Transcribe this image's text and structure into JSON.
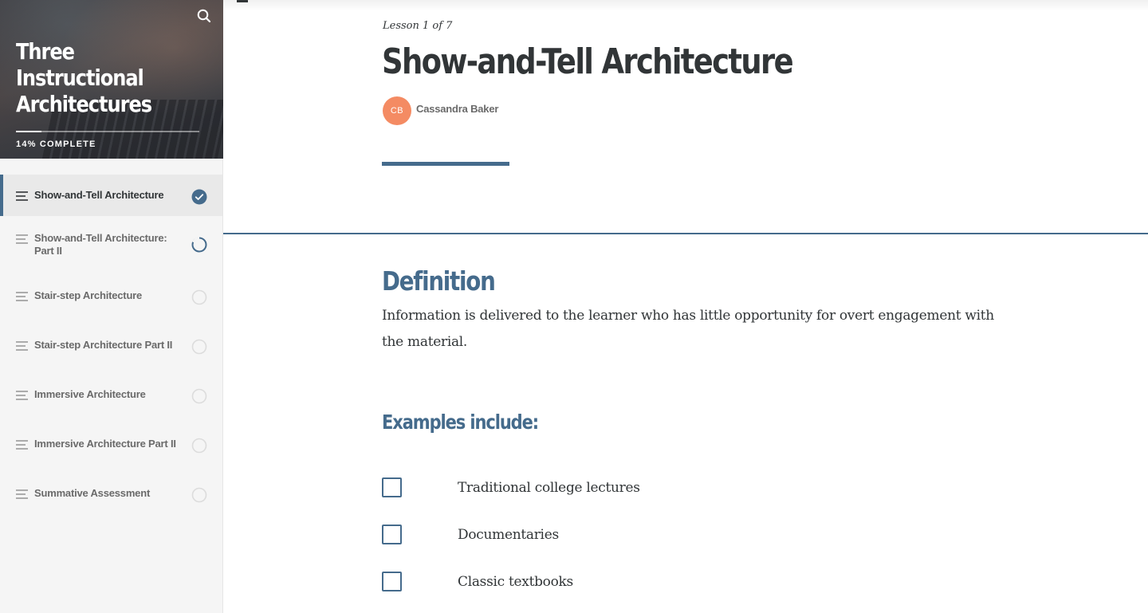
{
  "sidebar": {
    "course_title": "Three Instructional Architectures",
    "progress": {
      "label": "14% COMPLETE",
      "fraction": 0.14
    },
    "search_icon": "search-icon",
    "lessons": [
      {
        "title": "Show-and-Tell Architecture",
        "status": "complete",
        "active": true
      },
      {
        "title": "Show-and-Tell Architecture: Part II",
        "status": "in-progress",
        "active": false
      },
      {
        "title": "Stair-step Architecture",
        "status": "not-started",
        "active": false
      },
      {
        "title": "Stair-step Architecture Part II",
        "status": "not-started",
        "active": false
      },
      {
        "title": "Immersive Architecture",
        "status": "not-started",
        "active": false
      },
      {
        "title": "Immersive Architecture Part II",
        "status": "not-started",
        "active": false
      },
      {
        "title": "Summative Assessment",
        "status": "not-started",
        "active": false
      }
    ]
  },
  "lesson": {
    "count_label": "Lesson 1 of 7",
    "title": "Show-and-Tell Architecture",
    "author": {
      "initials": "CB",
      "name": "Cassandra Baker",
      "avatar_color": "#f48b63"
    }
  },
  "content": {
    "definition_heading": "Definition",
    "definition_text": "Information is delivered to the learner who has little opportunity for overt engagement with the material.",
    "examples_heading": "Examples include:",
    "examples": [
      {
        "label": "Traditional college lectures",
        "checked": false
      },
      {
        "label": "Documentaries",
        "checked": false
      },
      {
        "label": "Classic textbooks",
        "checked": false
      }
    ]
  },
  "colors": {
    "accent": "#456b8c",
    "text": "#313537",
    "muted": "#6a6a6a",
    "sidebar_bg": "#f5f5f5"
  }
}
